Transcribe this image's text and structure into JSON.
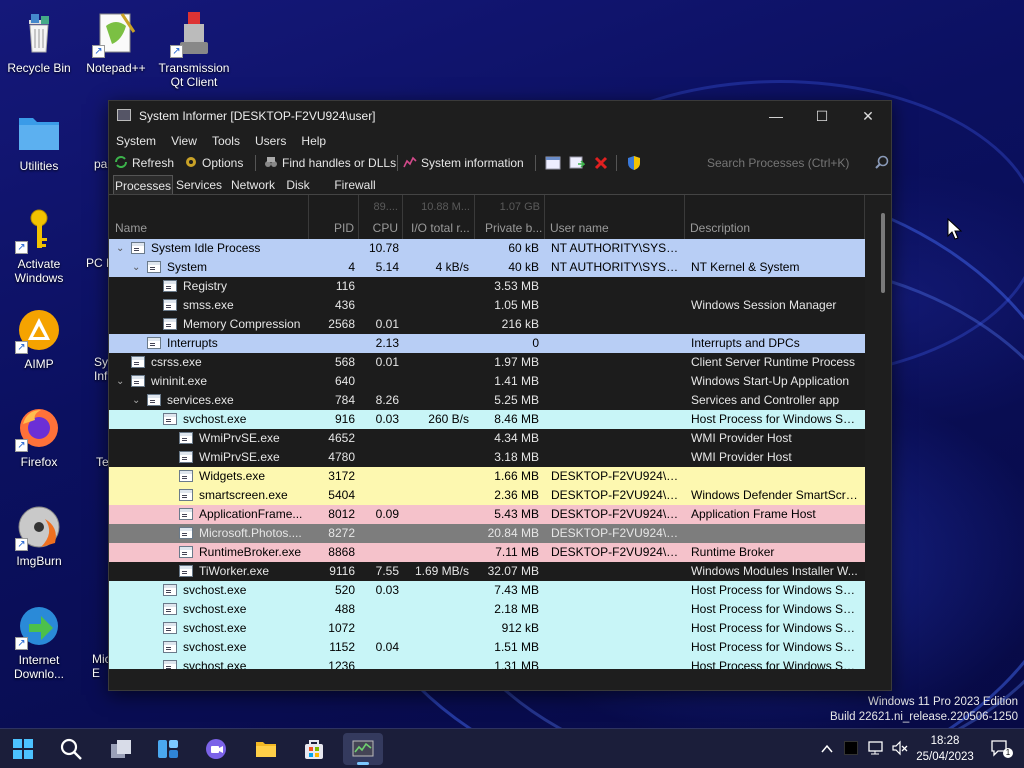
{
  "desktop": {
    "icons": [
      {
        "label": "Recycle Bin"
      },
      {
        "label": "Notepad++"
      },
      {
        "label": "Transmission Qt Client"
      },
      {
        "label": "Utilities"
      },
      {
        "label": "Activate Windows"
      },
      {
        "label": "AIMP"
      },
      {
        "label": "Firefox"
      },
      {
        "label": "ImgBurn"
      },
      {
        "label": "Internet Downlo..."
      }
    ],
    "partial_labels": [
      "pai",
      "PC M",
      "Sy Inf",
      "Te",
      "Mic E"
    ]
  },
  "window": {
    "title": "System Informer [DESKTOP-F2VU924\\user]",
    "controls": {
      "minimize": "—",
      "maximize": "☐",
      "close": "✕"
    },
    "menu": [
      "System",
      "View",
      "Tools",
      "Users",
      "Help"
    ],
    "toolbar": {
      "refresh": "Refresh",
      "options": "Options",
      "find_handles": "Find handles or DLLs",
      "system_information": "System information",
      "search_placeholder": "Search Processes (Ctrl+K)"
    },
    "tabs": [
      "Processes",
      "Services",
      "Network",
      "Disk",
      "Firewall"
    ],
    "active_tab": "Processes"
  },
  "process_table": {
    "columns": [
      "Name",
      "PID",
      "CPU",
      "I/O total r...",
      "Private b...",
      "User name",
      "Description"
    ],
    "column_summaries": {
      "cpu": "89....",
      "io": "10.88 M...",
      "private": "1.07 GB"
    },
    "rows": [
      {
        "name": "System Idle Process",
        "pid": "",
        "cpu": "10.78",
        "io": "",
        "private": "60 kB",
        "user": "NT AUTHORITY\\SYSTEM",
        "description": "",
        "color": "#b8cef5"
      },
      {
        "name": "System",
        "pid": "4",
        "cpu": "5.14",
        "io": "4 kB/s",
        "private": "40 kB",
        "user": "NT AUTHORITY\\SYSTEM",
        "description": "NT Kernel & System",
        "color": "#b8cef5"
      },
      {
        "name": "Registry",
        "pid": "116",
        "cpu": "",
        "io": "",
        "private": "3.53 MB",
        "user": "",
        "description": "",
        "color": ""
      },
      {
        "name": "smss.exe",
        "pid": "436",
        "cpu": "",
        "io": "",
        "private": "1.05 MB",
        "user": "",
        "description": "Windows Session Manager",
        "color": ""
      },
      {
        "name": "Memory Compression",
        "pid": "2568",
        "cpu": "0.01",
        "io": "",
        "private": "216 kB",
        "user": "",
        "description": "",
        "color": ""
      },
      {
        "name": "Interrupts",
        "pid": "",
        "cpu": "2.13",
        "io": "",
        "private": "0",
        "user": "",
        "description": "Interrupts and DPCs",
        "color": "#b8cef5"
      },
      {
        "name": "csrss.exe",
        "pid": "568",
        "cpu": "0.01",
        "io": "",
        "private": "1.97 MB",
        "user": "",
        "description": "Client Server Runtime Process",
        "color": ""
      },
      {
        "name": "wininit.exe",
        "pid": "640",
        "cpu": "",
        "io": "",
        "private": "1.41 MB",
        "user": "",
        "description": "Windows Start-Up Application",
        "color": ""
      },
      {
        "name": "services.exe",
        "pid": "784",
        "cpu": "8.26",
        "io": "",
        "private": "5.25 MB",
        "user": "",
        "description": "Services and Controller app",
        "color": ""
      },
      {
        "name": "svchost.exe",
        "pid": "916",
        "cpu": "0.03",
        "io": "260 B/s",
        "private": "8.46 MB",
        "user": "",
        "description": "Host Process for Windows Ser...",
        "color": "#c8f5f7"
      },
      {
        "name": "WmiPrvSE.exe",
        "pid": "4652",
        "cpu": "",
        "io": "",
        "private": "4.34 MB",
        "user": "",
        "description": "WMI Provider Host",
        "color": ""
      },
      {
        "name": "WmiPrvSE.exe",
        "pid": "4780",
        "cpu": "",
        "io": "",
        "private": "3.18 MB",
        "user": "",
        "description": "WMI Provider Host",
        "color": ""
      },
      {
        "name": "Widgets.exe",
        "pid": "3172",
        "cpu": "",
        "io": "",
        "private": "1.66 MB",
        "user": "DESKTOP-F2VU924\\user",
        "description": "",
        "color": "#fdf8b0"
      },
      {
        "name": "smartscreen.exe",
        "pid": "5404",
        "cpu": "",
        "io": "",
        "private": "2.36 MB",
        "user": "DESKTOP-F2VU924\\user",
        "description": "Windows Defender SmartScreen",
        "color": "#fdf8b0"
      },
      {
        "name": "ApplicationFrame...",
        "pid": "8012",
        "cpu": "0.09",
        "io": "",
        "private": "5.43 MB",
        "user": "DESKTOP-F2VU924\\user",
        "description": "Application Frame Host",
        "color": "#f5c2cb"
      },
      {
        "name": "Microsoft.Photos....",
        "pid": "8272",
        "cpu": "",
        "io": "",
        "private": "20.84 MB",
        "user": "DESKTOP-F2VU924\\user",
        "description": "",
        "color": "#7d7d7d"
      },
      {
        "name": "RuntimeBroker.exe",
        "pid": "8868",
        "cpu": "",
        "io": "",
        "private": "7.11 MB",
        "user": "DESKTOP-F2VU924\\user",
        "description": "Runtime Broker",
        "color": "#f5c2cb"
      },
      {
        "name": "TiWorker.exe",
        "pid": "9116",
        "cpu": "7.55",
        "io": "1.69 MB/s",
        "private": "32.07 MB",
        "user": "",
        "description": "Windows Modules Installer W...",
        "color": ""
      },
      {
        "name": "svchost.exe",
        "pid": "520",
        "cpu": "0.03",
        "io": "",
        "private": "7.43 MB",
        "user": "",
        "description": "Host Process for Windows Ser...",
        "color": "#c8f5f7"
      },
      {
        "name": "svchost.exe",
        "pid": "488",
        "cpu": "",
        "io": "",
        "private": "2.18 MB",
        "user": "",
        "description": "Host Process for Windows Ser...",
        "color": "#c8f5f7"
      },
      {
        "name": "svchost.exe",
        "pid": "1072",
        "cpu": "",
        "io": "",
        "private": "912 kB",
        "user": "",
        "description": "Host Process for Windows Ser...",
        "color": "#c8f5f7"
      },
      {
        "name": "svchost.exe",
        "pid": "1152",
        "cpu": "0.04",
        "io": "",
        "private": "1.51 MB",
        "user": "",
        "description": "Host Process for Windows Ser...",
        "color": "#c8f5f7"
      },
      {
        "name": "svchost.exe",
        "pid": "1236",
        "cpu": "",
        "io": "",
        "private": "1.31 MB",
        "user": "",
        "description": "Host Process for Windows Ser...",
        "color": "#c8f5f7"
      }
    ]
  },
  "watermark": {
    "line1": "Windows 11 Pro 2023 Edition",
    "line2": "Build 22621.ni_release.220506-1250"
  },
  "taskbar": {
    "time": "18:28",
    "date": "25/04/2023",
    "notification_count": "1"
  },
  "colors": {
    "system_process": "#b8cef5",
    "service_process": "#c8f5f7",
    "user_process": "#fdf8b0",
    "immersive_process": "#f5c2cb",
    "suspended_process": "#7d7d7d"
  }
}
